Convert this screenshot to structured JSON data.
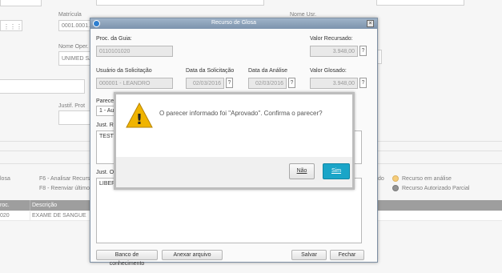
{
  "background": {
    "matricula": {
      "label": "Matrícula",
      "value": "0001.0001.0"
    },
    "nome_usr": {
      "label": "Nome Usr."
    },
    "nome_oper": {
      "label": "Nome Oper.",
      "value": "UNIMED SAN"
    },
    "justif_prot": {
      "label": "Justif. Prot"
    },
    "shortcuts": {
      "f6_analisar": "F6 - Analisar Recurso",
      "f8_reenviar": "F8 - Reenviar último e",
      "left_frag": "losa",
      "right_frag": "do"
    },
    "legend": [
      {
        "label": "Recurso em análise",
        "color": "#f2b233"
      },
      {
        "label": "Recurso Autorizado Parcial",
        "color": "#5a5a5a"
      }
    ],
    "grid": {
      "headers": [
        "roc.",
        "Descrição"
      ],
      "rows": [
        [
          "020",
          "EXAME DE SANGUE"
        ]
      ]
    }
  },
  "dialog": {
    "title": "Recurso de Glosa",
    "proc_guia": {
      "label": "Proc. da Guia:",
      "value": "0110101020"
    },
    "valor_recursado": {
      "label": "Valor Recursado:",
      "value": "3.948,00"
    },
    "usuario_solicitacao": {
      "label": "Usuário da Solicitação",
      "value": "000001 - LEANDRO"
    },
    "data_solicitacao": {
      "label": "Data da Solicitação",
      "value": "02/03/2016"
    },
    "data_analise": {
      "label": "Data da Análise",
      "value": "02/03/2016"
    },
    "valor_glosado": {
      "label": "Valor Glosado:",
      "value": "3.948,00"
    },
    "parecer": {
      "label": "Parecer",
      "value": "1 - Au"
    },
    "just_r": {
      "label": "Just. R",
      "value": "TESTE"
    },
    "just_o": {
      "label": "Just. O",
      "value": "LIBERA"
    },
    "help_glyph": "?",
    "buttons": {
      "banco": "Banco de conhecimento",
      "anexar": "Anexar arquivo",
      "salvar": "Salvar",
      "fechar": "Fechar"
    }
  },
  "confirm": {
    "message": "O parecer informado foi \"Aprovado\". Confirma o parecer?",
    "warning_glyph": "!",
    "no_label": "Não",
    "yes_label": "Sim"
  },
  "colors": {
    "accent": "#1aa5c8",
    "dialog_title_bg": "#8aa0b8",
    "grid_header_bg": "#6b6b6b",
    "warning": "#f0b400"
  },
  "icons": {
    "title": "app-logo-icon",
    "close": "close-icon",
    "warning": "warning-icon",
    "lookup": "grid-lookup-icon"
  }
}
